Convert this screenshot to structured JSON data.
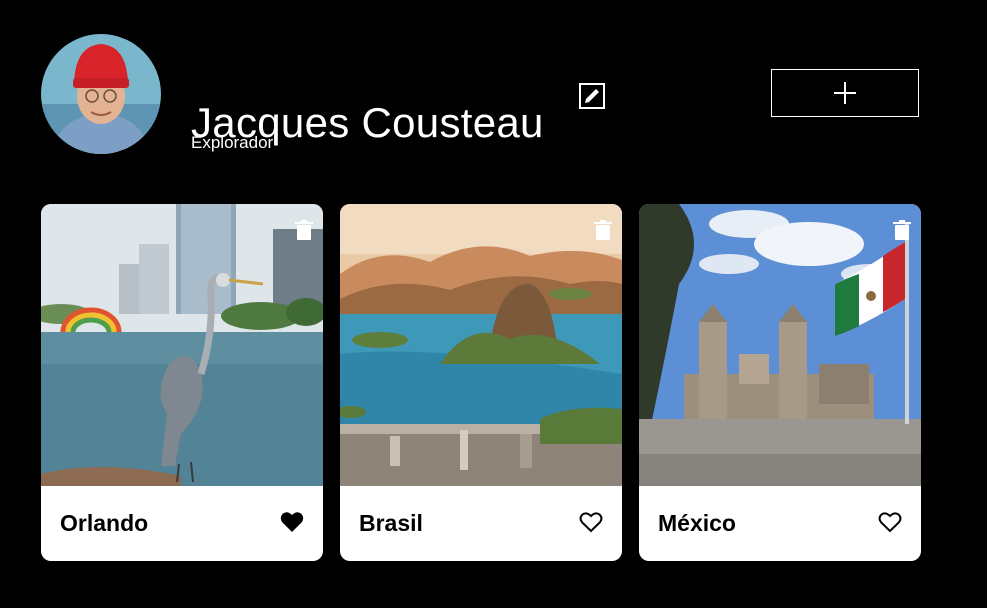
{
  "profile": {
    "name": "Jacques Cousteau",
    "about": "Explorador"
  },
  "actions": {
    "edit_icon": "pencil-edit-icon",
    "add_icon": "plus-icon",
    "trash_icon": "trash-icon",
    "like_icon": "heart-icon"
  },
  "cards": [
    {
      "title": "Orlando",
      "liked": true
    },
    {
      "title": "Brasil",
      "liked": false
    },
    {
      "title": "México",
      "liked": false
    }
  ],
  "colors": {
    "background": "#000000",
    "text": "#ffffff",
    "card": "#ffffff",
    "card_text": "#000000"
  }
}
